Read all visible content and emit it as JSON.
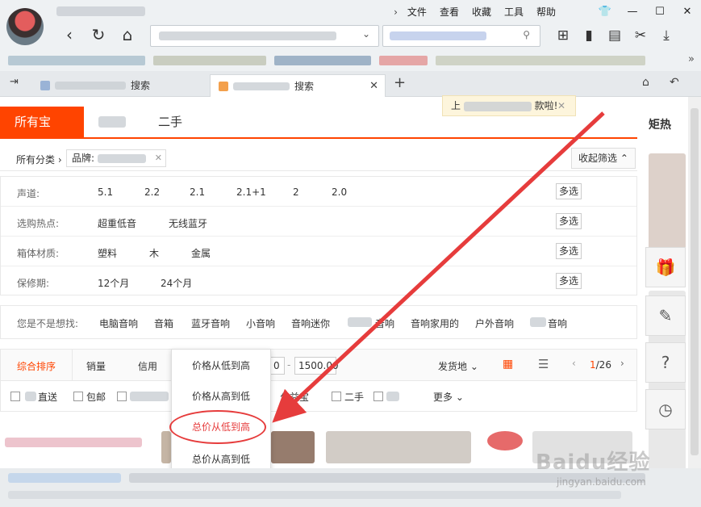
{
  "browser": {
    "menu": [
      "文件",
      "查看",
      "收藏",
      "工具",
      "帮助"
    ],
    "window_controls": [
      "—",
      "☐",
      "✕"
    ],
    "tabs": [
      {
        "label": "搜索"
      },
      {
        "label": "搜索",
        "active": true
      }
    ],
    "toast": "款啦!"
  },
  "page": {
    "tabs": [
      "所有宝",
      "二手"
    ],
    "breadcrumb": {
      "all": "所有分类",
      "brand_label": "品牌:"
    },
    "collapse_label": "收起筛选",
    "filter_rows": [
      {
        "label": "声道:",
        "options": [
          "5.1",
          "2.2",
          "2.1",
          "2.1+1",
          "2",
          "2.0"
        ],
        "multi": "多选"
      },
      {
        "label": "选购热点:",
        "options": [
          "超重低音",
          "无线蓝牙"
        ],
        "multi": "多选"
      },
      {
        "label": "箱体材质:",
        "options": [
          "塑料",
          "木",
          "金属"
        ],
        "multi": "多选"
      },
      {
        "label": "保修期:",
        "options": [
          "12个月",
          "24个月"
        ],
        "multi": "多选"
      }
    ],
    "suggest": {
      "label": "您是不是想找:",
      "items": [
        "电脑音响",
        "音箱",
        "蓝牙音响",
        "小音响",
        "音响迷你",
        "音响",
        "音响家用的",
        "户外音响",
        "音响"
      ]
    },
    "sortbar": {
      "items": [
        "综合排序",
        "销量",
        "信用"
      ],
      "price_to": "1500.00",
      "price_from_suffix": "0",
      "ship_from": "发货地",
      "page_indicator": {
        "current": "1",
        "total": "/26"
      }
    },
    "options": [
      "直送",
      "包邮",
      "公益宝",
      "二手",
      "更多"
    ],
    "dropdown": [
      "价格从低到高",
      "价格从高到低",
      "总价从低到高",
      "总价从高到低"
    ],
    "highlighted_option": "总价从低到高"
  },
  "right_panel": {
    "hot_label": "矩热"
  },
  "watermark": {
    "brand": "Baidu经验",
    "url": "jingyan.baidu.com"
  },
  "colors": {
    "accent": "#ff4400",
    "annotation": "#e63c3c"
  }
}
